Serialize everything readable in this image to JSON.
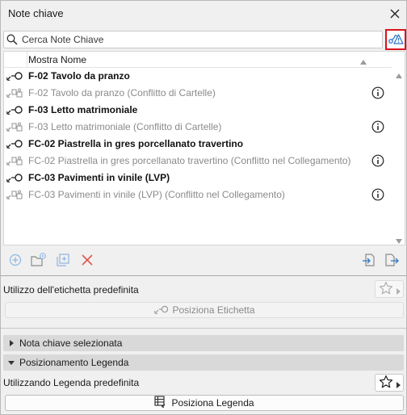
{
  "window": {
    "title": "Note chiave"
  },
  "search": {
    "placeholder": "Cerca Note Chiave"
  },
  "list": {
    "column_header": "Mostra Nome",
    "rows": [
      {
        "text": "F-02 Tavolo da pranzo",
        "state": "placed",
        "info": false
      },
      {
        "text": "F-02 Tavolo da pranzo (Conflitto di Cartelle)",
        "state": "conflict",
        "info": true
      },
      {
        "text": "F-03 Letto matrimoniale",
        "state": "placed",
        "info": false
      },
      {
        "text": "F-03 Letto matrimoniale (Conflitto di Cartelle)",
        "state": "conflict",
        "info": true
      },
      {
        "text": "FC-02 Piastrella in gres porcellanato travertino",
        "state": "placed",
        "info": false
      },
      {
        "text": "FC-02 Piastrella in gres porcellanato travertino (Conflitto nel Collegamento)",
        "state": "conflict",
        "info": true
      },
      {
        "text": "FC-03 Pavimenti in vinile (LVP)",
        "state": "placed",
        "info": false
      },
      {
        "text": "FC-03 Pavimenti in vinile (LVP) (Conflitto nel Collegamento)",
        "state": "conflict",
        "info": true
      }
    ]
  },
  "label_section": {
    "title": "Utilizzo dell'etichetta predefinita",
    "button": "Posiziona Etichetta"
  },
  "selected_note_section": {
    "title": "Nota chiave selezionata"
  },
  "legend_section": {
    "title": "Posizionamento Legenda",
    "default_label": "Utilizzando Legenda predefinita",
    "button": "Posiziona Legenda"
  },
  "colors": {
    "highlight_border": "#d9141c",
    "icon_blue": "#2f77c6",
    "delete_red": "#e0584f"
  }
}
